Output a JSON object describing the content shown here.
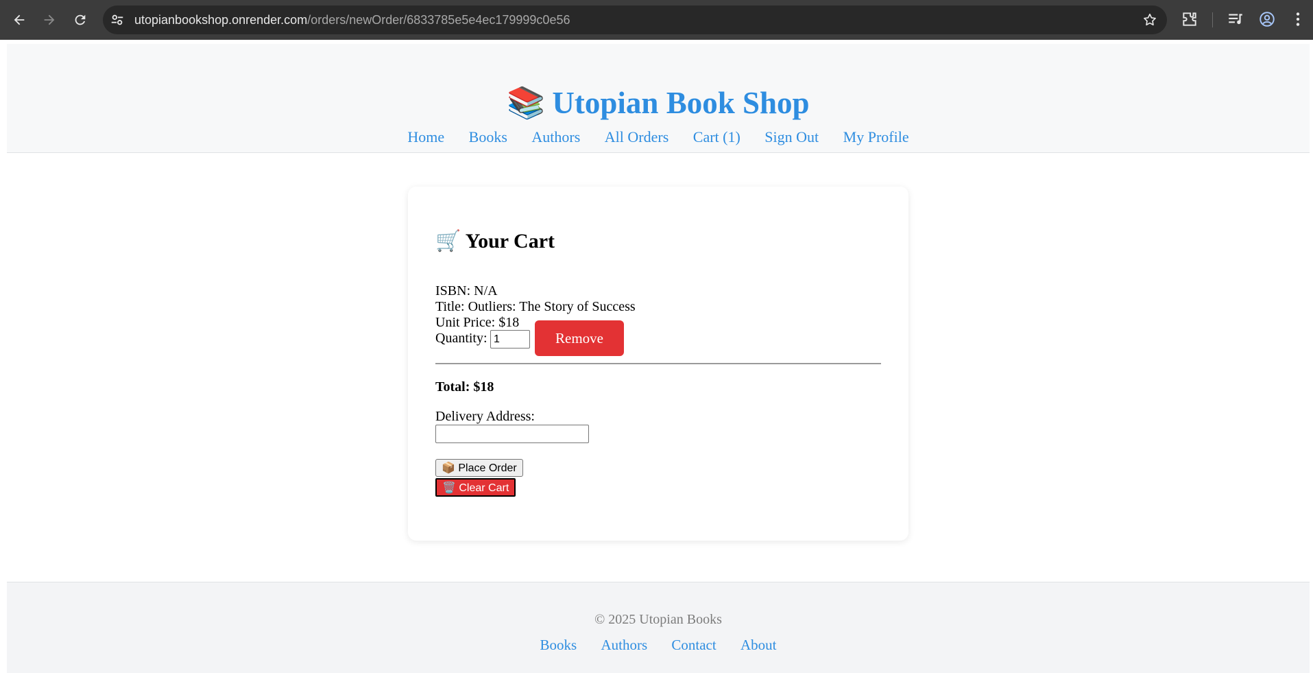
{
  "browser": {
    "url_host": "utopianbookshop.onrender.com",
    "url_path": "/orders/newOrder/6833785e5e4ec179999c0e56"
  },
  "header": {
    "logo_emoji": "📚",
    "title": "Utopian Book Shop",
    "nav": [
      "Home",
      "Books",
      "Authors",
      "All Orders",
      "Cart (1)",
      "Sign Out",
      "My Profile"
    ]
  },
  "cart": {
    "heading_emoji": "🛒",
    "heading": "Your Cart",
    "item": {
      "isbn": "ISBN: N/A",
      "title": "Title: Outliers: The Story of Success",
      "unit_price": "Unit Price: $18",
      "quantity_label": "Quantity:",
      "quantity_value": "1",
      "remove_label": "Remove"
    },
    "total": "Total: $18",
    "address_label": "Delivery Address:",
    "address_value": "",
    "place_order_label": "📦 Place Order",
    "clear_cart_label": "🗑️ Clear Cart"
  },
  "footer": {
    "copyright": "© 2025 Utopian Books",
    "links": [
      "Books",
      "Authors",
      "Contact",
      "About"
    ]
  },
  "colors": {
    "accent": "#2e8de0",
    "danger": "#e33234",
    "chrome_bg": "#3c3c3c"
  }
}
